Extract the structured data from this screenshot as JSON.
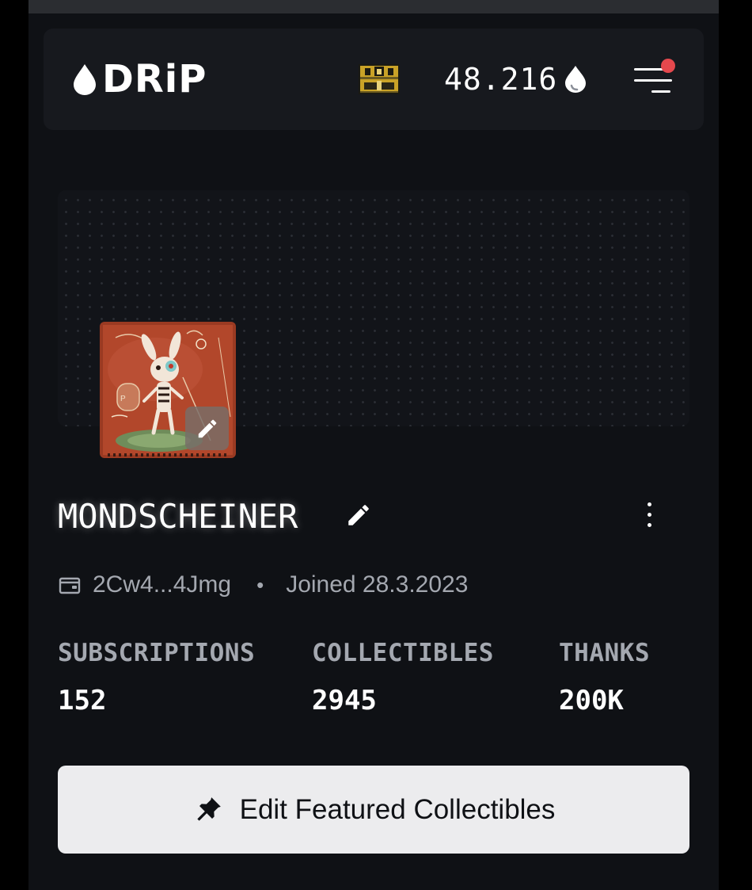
{
  "header": {
    "logo_text": "DRiP",
    "balance": "48.216",
    "icons": {
      "logo": "water-drop-icon",
      "chest": "treasure-chest-icon",
      "currency": "droplet-icon",
      "menu": "hamburger-menu-icon",
      "notification": "notification-dot"
    },
    "notification_color": "#e5484d"
  },
  "profile": {
    "username": "MONDSCHEINER",
    "wallet": "2Cw4...4Jmg",
    "separator": "•",
    "joined": "Joined 28.3.2023",
    "stats": [
      {
        "label": "SUBSCRIPTIONS",
        "value": "152"
      },
      {
        "label": "COLLECTIBLES",
        "value": "2945"
      },
      {
        "label": "THANKS",
        "value": "200K"
      }
    ],
    "icons": {
      "avatar_edit": "pencil-icon",
      "name_edit": "pencil-icon",
      "more": "kebab-menu-icon",
      "wallet": "wallet-icon"
    }
  },
  "actions": {
    "edit_featured_label": "Edit Featured Collectibles",
    "edit_featured_icon": "pin-icon"
  },
  "colors": {
    "background": "#0f1115",
    "header_bg": "#17191e",
    "muted_text": "#a4a8b0",
    "button_bg": "#ececee",
    "accent_gold": "#c9a227"
  }
}
